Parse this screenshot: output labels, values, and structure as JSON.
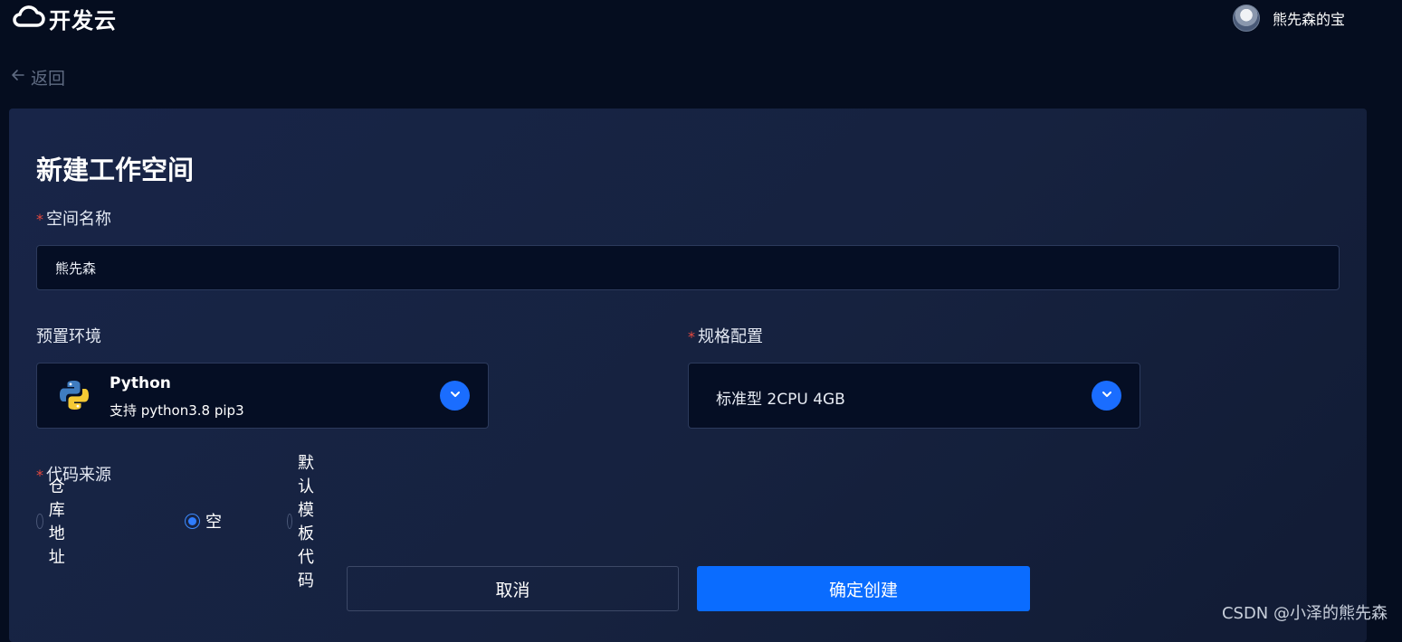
{
  "brand": {
    "name": "开发云"
  },
  "user": {
    "name": "熊先森的宝"
  },
  "nav": {
    "back_label": "返回"
  },
  "page": {
    "title": "新建工作空间"
  },
  "form": {
    "space_name": {
      "label": "空间名称",
      "required_mark": "*",
      "value": "熊先森"
    },
    "preset_env": {
      "label": "预置环境",
      "title": "Python",
      "subtitle": "支持 python3.8 pip3"
    },
    "spec": {
      "label": "规格配置",
      "required_mark": "*",
      "value": "标准型 2CPU 4GB"
    },
    "code_source": {
      "label": "代码来源",
      "required_mark": "*",
      "options": [
        {
          "label": "仓库地址",
          "checked": false
        },
        {
          "label": "空",
          "checked": true
        },
        {
          "label": "默认模板代码",
          "checked": false
        }
      ]
    }
  },
  "actions": {
    "cancel_label": "取消",
    "confirm_label": "确定创建"
  },
  "watermark": "CSDN @小泽的熊先森",
  "colors": {
    "background": "#050d1f",
    "card": "#182548",
    "primary": "#0a6cff",
    "required": "#e5493f",
    "input_bg": "#050e24"
  }
}
